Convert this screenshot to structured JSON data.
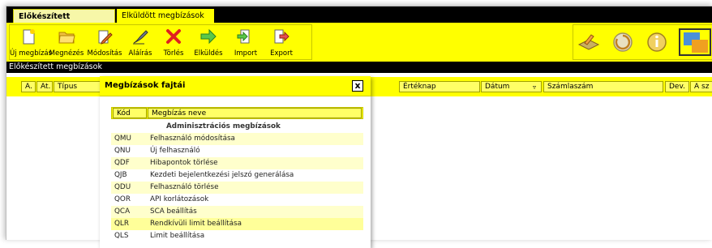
{
  "tabs": [
    {
      "label": "Előkészített megbízások",
      "active": true
    },
    {
      "label": "Elküldött megbízások",
      "active": false
    }
  ],
  "toolbar": {
    "buttons": [
      {
        "label": "Új megbízás",
        "icon": "new-document-icon"
      },
      {
        "label": "Megnézés",
        "icon": "open-folder-icon"
      },
      {
        "label": "Módosítás",
        "icon": "edit-pencil-icon"
      },
      {
        "label": "Aláírás",
        "icon": "signature-pen-icon"
      },
      {
        "label": "Törlés",
        "icon": "delete-x-icon"
      },
      {
        "label": "Elküldés",
        "icon": "send-arrow-icon"
      },
      {
        "label": "Import",
        "icon": "import-icon"
      },
      {
        "label": "Export",
        "icon": "export-icon"
      }
    ],
    "right_icons": [
      "sign-pad-icon",
      "refresh-icon",
      "info-icon",
      "settings-icon"
    ]
  },
  "section_title": "Előkészített megbízások",
  "columns": {
    "a": "A.",
    "at": "At.",
    "tipus": "Típus",
    "erteknap": "Értéknap",
    "datum": "Dátum",
    "szamlaszam": "Számlaszám",
    "dev": "Dev.",
    "asz": "A sz"
  },
  "dialog": {
    "title": "Megbízások fajtái",
    "close": "x",
    "col_code": "Kód",
    "col_name": "Megbízás neve",
    "rows": [
      {
        "code": "",
        "name": "Adminisztrációs megbízások",
        "group": true
      },
      {
        "code": "QMU",
        "name": "Felhasználó módosítása"
      },
      {
        "code": "QNU",
        "name": "Új felhasználó"
      },
      {
        "code": "QDF",
        "name": "Hibapontok törlése"
      },
      {
        "code": "QJB",
        "name": "Kezdeti bejelentkezési jelszó generálása"
      },
      {
        "code": "QDU",
        "name": "Felhasználó törlése"
      },
      {
        "code": "QOR",
        "name": "API korlátozások"
      },
      {
        "code": "QCA",
        "name": "SCA beállítás"
      },
      {
        "code": "QLR",
        "name": "Rendkívüli limit beállítása"
      },
      {
        "code": "QLS",
        "name": "Limit beállítása"
      }
    ]
  },
  "colors": {
    "accent_yellow": "#ffff00",
    "header_black": "#000000",
    "row_highlight": "#ffffcc"
  }
}
